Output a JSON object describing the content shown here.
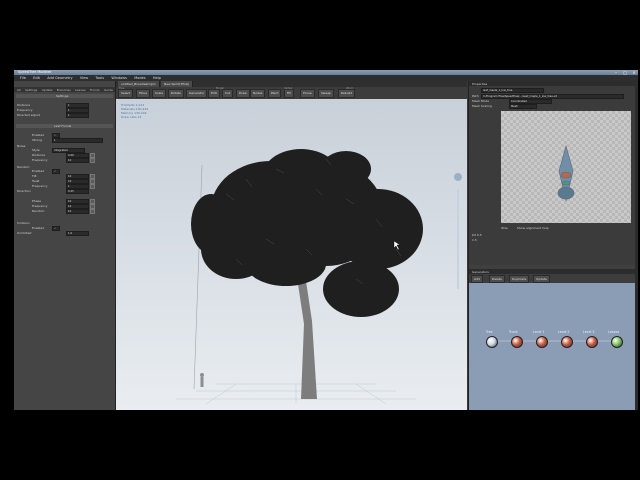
{
  "window": {
    "title": "SpeedTree Modeler",
    "controls": [
      "–",
      "□",
      "×"
    ]
  },
  "menu": [
    "File",
    "Edit",
    "Add Geometry",
    "View",
    "Tools",
    "Windows",
    "Modes",
    "Help"
  ],
  "left_panel": {
    "tabs": [
      "All",
      "Settings",
      "Update",
      "Branches",
      "Leaves",
      "Fronds",
      "Guide",
      "Edit"
    ],
    "sections": [
      "Settings",
      "Leaf Fronds",
      "Noise",
      "Random",
      "Collision"
    ],
    "params": [
      {
        "label": "Distance",
        "value": "1"
      },
      {
        "label": "Frequency",
        "value": "1"
      },
      {
        "label": "Directed adjust",
        "value": "1"
      },
      {
        "label": "Enabled",
        "value": "✓"
      },
      {
        "label": "Strong",
        "value": "1"
      },
      {
        "label": "Style",
        "value": "Integrated"
      },
      {
        "label": "Distance",
        "value": "0.00"
      },
      {
        "label": "Frequency",
        "value": "10"
      },
      {
        "label": "Enabled",
        "value": "✓"
      },
      {
        "label": "Tilt",
        "value": "10"
      },
      {
        "label": "Twist",
        "value": "10"
      },
      {
        "label": "Frequency",
        "value": "1"
      },
      {
        "label": "Direction",
        "value": "0.25"
      },
      {
        "label": "Phase",
        "value": "10"
      },
      {
        "label": "Frequency",
        "value": "10"
      },
      {
        "label": "Random",
        "value": "10"
      },
      {
        "label": "Enabled",
        "value": "✓"
      },
      {
        "label": "Unlimited",
        "value": "1.0"
      }
    ]
  },
  "center": {
    "tabs": [
      "untitled_Broadleaf.spm",
      "New Spmt(TPrel)"
    ],
    "toolbar_groups": [
      "Tree",
      "Model",
      "Vertex",
      "Wind"
    ],
    "tools": [
      "Select",
      "Move",
      "Scale",
      "Rotate",
      "Generator",
      "Edit",
      "Cut",
      "Draw",
      "Nodes",
      "Paint",
      "Fill",
      "Prune",
      "Sweep",
      "Rebuild"
    ],
    "stats": [
      "Tris/Verts",
      "1,212",
      "Materials",
      "130,244",
      "Memory",
      "130,244",
      "Draw calls",
      "13"
    ]
  },
  "right_panel": {
    "title": "Properties",
    "asset": "leaf_maple_1_low_tree",
    "path_label": "Path",
    "path": "C:/Program Files/SpeedTree/…/Leaf_maple_1_low_tree.srt",
    "rows": [
      {
        "label": "Mesh Mode",
        "value": "Coordinated"
      },
      {
        "label": "Mesh Scaling",
        "value": "Mesh"
      }
    ],
    "preview_options": [
      "Wire",
      "Show alignment help"
    ],
    "preview_values": [
      "Kit 0.5",
      "1.5"
    ]
  },
  "generators": {
    "title": "Generators",
    "tools": [
      "Add",
      "Delete",
      "Duplicate",
      "Update"
    ],
    "nodes": [
      {
        "name": "Tree",
        "color": "#cfd8e6"
      },
      {
        "name": "Trunk",
        "color": "#d25a3c"
      },
      {
        "name": "Level 1",
        "color": "#d25a3c"
      },
      {
        "name": "Level 2",
        "color": "#d25a3c"
      },
      {
        "name": "Level 3",
        "color": "#d25a3c"
      },
      {
        "name": "Leaves",
        "color": "#7fc85a"
      }
    ]
  }
}
